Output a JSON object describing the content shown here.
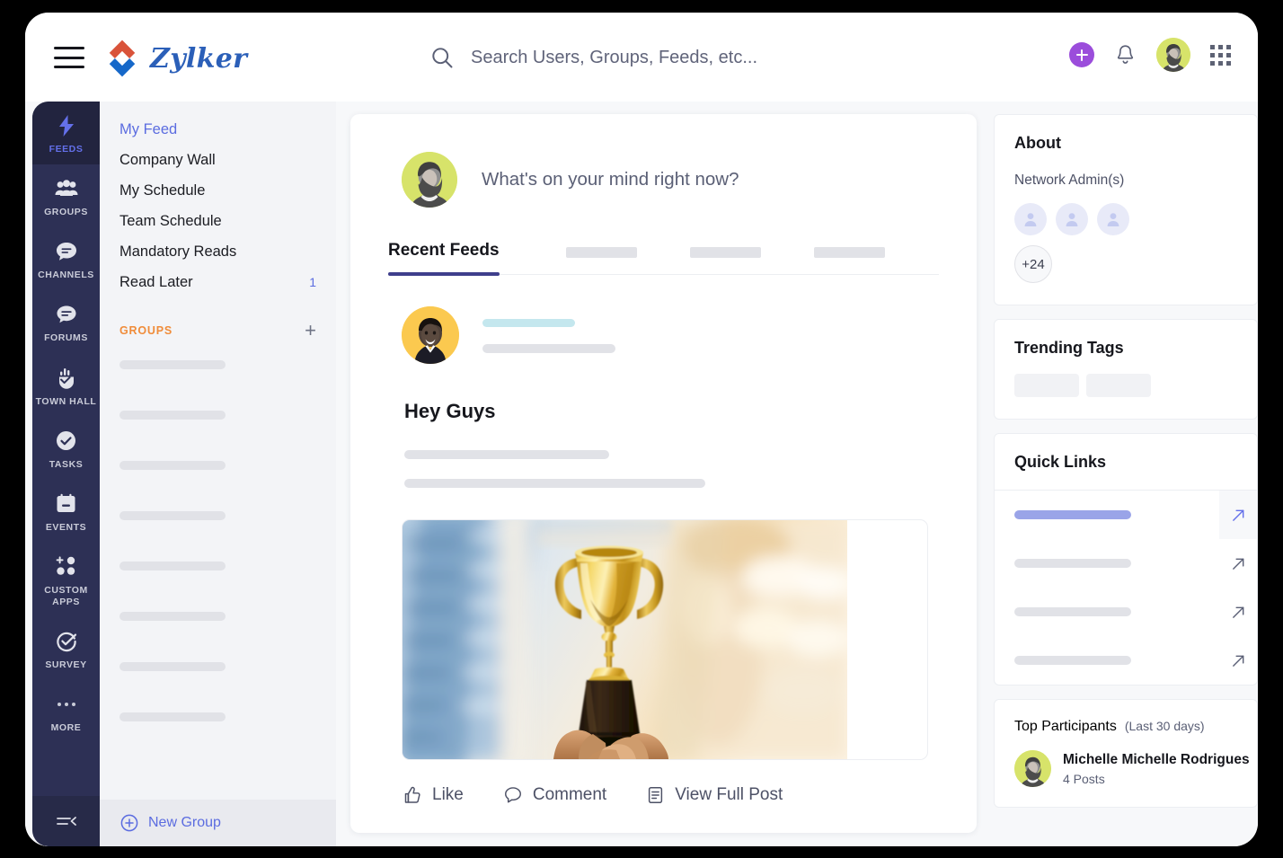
{
  "brand": {
    "logo_text": "Zylker",
    "logo_color_top": "#d9533a",
    "logo_color_bottom": "#1668c9",
    "accent_purple": "#9b4ddb",
    "accent_blue": "#5b6ce0",
    "accent_orange": "#f08c3a"
  },
  "topbar": {
    "menu_icon": "hamburger-menu-icon",
    "search": {
      "icon": "search-icon",
      "value": "",
      "placeholder": "Search Users, Groups, Feeds, etc..."
    },
    "actions": [
      {
        "name": "add-button",
        "icon": "plus-circle-icon"
      },
      {
        "name": "notifications-button",
        "icon": "bell-icon"
      },
      {
        "name": "profile-avatar",
        "icon": "avatar"
      },
      {
        "name": "apps-button",
        "icon": "grid-apps-icon"
      }
    ]
  },
  "rail": {
    "items": [
      {
        "label": "FEEDS",
        "icon": "lightning-bolt-icon",
        "active": true
      },
      {
        "label": "GROUPS",
        "icon": "people-group-icon",
        "active": false
      },
      {
        "label": "CHANNELS",
        "icon": "chat-bubble-lines-icon",
        "active": false
      },
      {
        "label": "FORUMS",
        "icon": "chat-bubbles-icon",
        "active": false
      },
      {
        "label": "TOWN HALL",
        "icon": "megaphone-icon",
        "active": false
      },
      {
        "label": "TASKS",
        "icon": "check-circle-icon",
        "active": false
      },
      {
        "label": "EVENTS",
        "icon": "calendar-icon",
        "active": false
      },
      {
        "label": "CUSTOM APPS",
        "icon": "app-grid-plus-icon",
        "active": false
      },
      {
        "label": "SURVEY",
        "icon": "survey-check-icon",
        "active": false
      },
      {
        "label": "MORE",
        "icon": "ellipsis-icon",
        "active": false
      }
    ],
    "collapse_icon": "collapse-sidebar-icon"
  },
  "subnav": {
    "items": [
      {
        "label": "My Feed",
        "badge": "",
        "active": true
      },
      {
        "label": "Company Wall",
        "badge": "",
        "active": false
      },
      {
        "label": "My Schedule",
        "badge": "",
        "active": false
      },
      {
        "label": "Team Schedule",
        "badge": "",
        "active": false
      },
      {
        "label": "Mandatory Reads",
        "badge": "",
        "active": false
      },
      {
        "label": "Read Later",
        "badge": "1",
        "active": false
      }
    ],
    "groups_section": {
      "title": "GROUPS",
      "add_label": "+",
      "placeholder_count": 8
    },
    "new_group": {
      "label": "New Group",
      "icon": "plus-circle-outline-icon"
    }
  },
  "feed": {
    "composer": {
      "placeholder": "What's on your mind right now?",
      "avatar": "avatar"
    },
    "tabs": [
      {
        "label": "Recent Feeds",
        "active": true
      },
      {
        "label": "",
        "active": false
      },
      {
        "label": "",
        "active": false
      },
      {
        "label": "",
        "active": false
      }
    ],
    "post": {
      "author_placeholder": true,
      "timestamp_placeholder": true,
      "title": "Hey Guys",
      "body_placeholder_lines": 2,
      "image": "trophy-held-aloft-photo",
      "actions": [
        {
          "label": "Like",
          "icon": "thumbs-up-icon"
        },
        {
          "label": "Comment",
          "icon": "comment-bubble-icon"
        },
        {
          "label": "View Full Post",
          "icon": "document-icon"
        }
      ]
    }
  },
  "right": {
    "about": {
      "title": "About",
      "admins_label": "Network Admin(s)",
      "admin_avatar_count": 3,
      "more_admins": "+24"
    },
    "trending": {
      "title": "Trending Tags",
      "tag_placeholder_count": 2
    },
    "quick_links": {
      "title": "Quick Links",
      "rows": [
        {
          "active": true,
          "icon": "external-link-arrow-icon"
        },
        {
          "active": false,
          "icon": "external-link-arrow-icon"
        },
        {
          "active": false,
          "icon": "external-link-arrow-icon"
        },
        {
          "active": false,
          "icon": "external-link-arrow-icon"
        }
      ]
    },
    "top_participants": {
      "title": "Top Participants",
      "subtitle": "(Last 30 days)",
      "people": [
        {
          "name": "Michelle Michelle Rodrigues",
          "posts": "4 Posts"
        }
      ]
    }
  }
}
